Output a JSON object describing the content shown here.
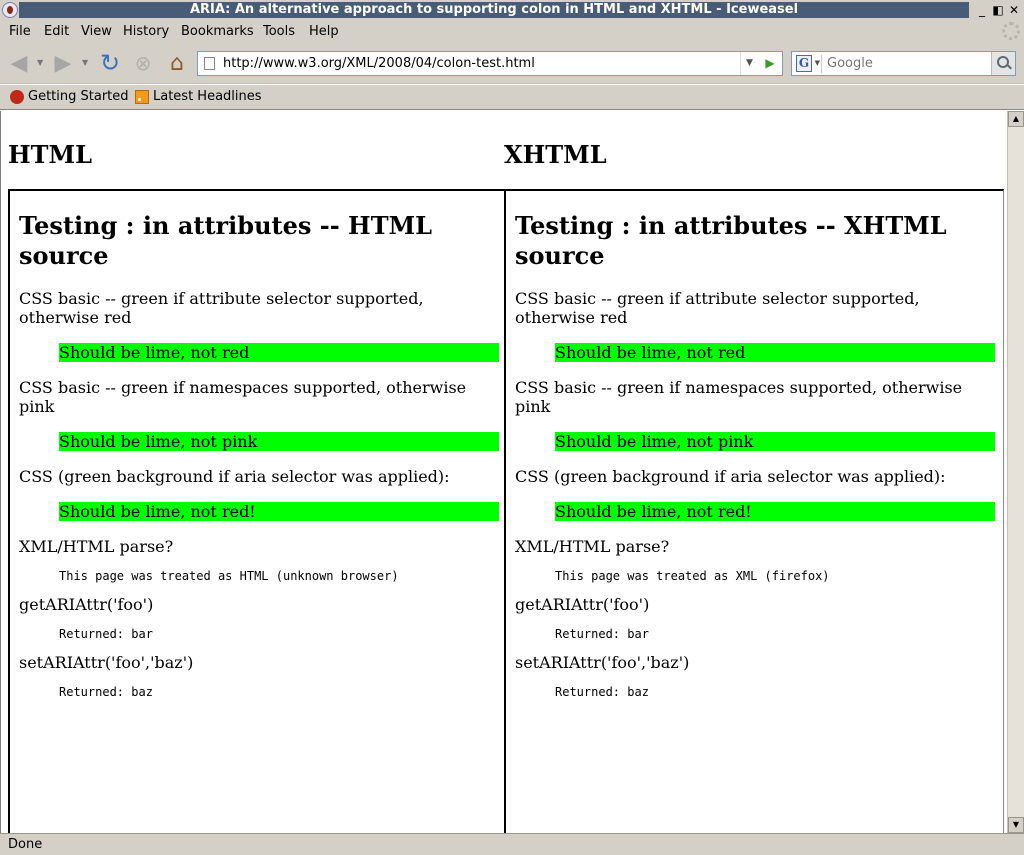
{
  "window": {
    "title": "ARIA: An alternative approach to supporting colon in HTML and XHTML - Iceweasel",
    "controls": {
      "minimize": "_",
      "maximize": "◧",
      "close": "✕"
    }
  },
  "menu": {
    "items": [
      {
        "label": "File"
      },
      {
        "label": "Edit"
      },
      {
        "label": "View"
      },
      {
        "label": "History"
      },
      {
        "label": "Bookmarks"
      },
      {
        "label": "Tools"
      },
      {
        "label": "Help"
      }
    ]
  },
  "navigation": {
    "back_icon": "back-arrow-icon",
    "forward_icon": "forward-arrow-icon",
    "reload_icon": "reload-icon",
    "stop_icon": "stop-icon",
    "home_icon": "home-icon",
    "url": "http://www.w3.org/XML/2008/04/colon-test.html",
    "search_placeholder": "Google",
    "search_engine_icon": "google-icon"
  },
  "bookmarks": {
    "items": [
      {
        "label": "Getting Started",
        "icon": "firefox-icon"
      },
      {
        "label": "Latest Headlines",
        "icon": "rss-icon"
      }
    ]
  },
  "content": {
    "columns": [
      {
        "heading": "HTML",
        "frame_title": "Testing : in attributes -- HTML source",
        "css_attr_label": "CSS basic -- green if attribute selector supported, otherwise red",
        "css_attr_result": "Should be lime, not red",
        "css_ns_label": "CSS basic -- green if namespaces supported, otherwise pink",
        "css_ns_result": "Should be lime, not pink",
        "css_aria_label": "CSS (green background if aria selector was applied):",
        "css_aria_result": "Should be lime, not red!",
        "parse_label": "XML/HTML parse?",
        "parse_result": "This page was treated as HTML (unknown browser)",
        "get_label": "getARIAttr('foo')",
        "get_result": "Returned: bar",
        "set_label": "setARIAttr('foo','baz')",
        "set_result": "Returned: baz"
      },
      {
        "heading": "XHTML",
        "frame_title": "Testing : in attributes -- XHTML source",
        "css_attr_label": "CSS basic -- green if attribute selector supported, otherwise red",
        "css_attr_result": "Should be lime, not red",
        "css_ns_label": "CSS basic -- green if namespaces supported, otherwise pink",
        "css_ns_result": "Should be lime, not pink",
        "css_aria_label": "CSS (green background if aria selector was applied):",
        "css_aria_result": "Should be lime, not red!",
        "parse_label": "XML/HTML parse?",
        "parse_result": "This page was treated as XML (firefox)",
        "get_label": "getARIAttr('foo')",
        "get_result": "Returned: bar",
        "set_label": "setARIAttr('foo','baz')",
        "set_result": "Returned: baz"
      }
    ]
  },
  "status": {
    "text": "Done"
  },
  "colors": {
    "title_bar": "#485c78",
    "chrome": "#d4d0c8",
    "lime": "#00ff00"
  }
}
